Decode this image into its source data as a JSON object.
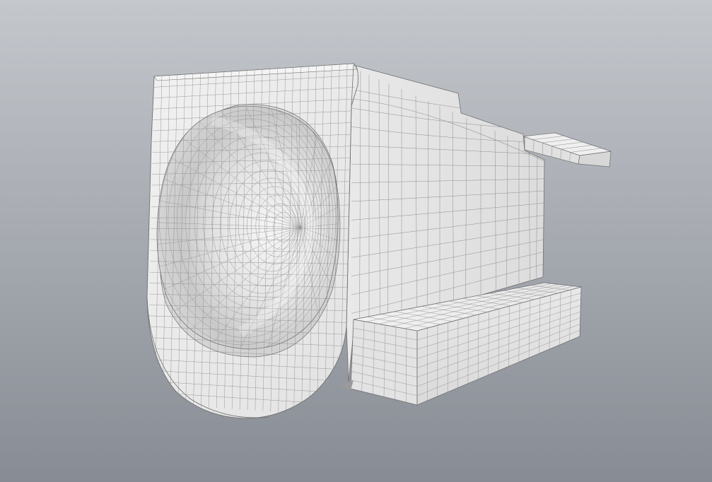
{
  "scene": {
    "kind": "3d-wireframe-model-render",
    "background_top_color": "#c4c8cd",
    "background_bottom_color": "#878b93",
    "surface_color": "#ededed",
    "surface_shadow_color": "#b9b9b9",
    "wire_color": "#8e8e8e",
    "edge_color": "#6f6f6f"
  }
}
